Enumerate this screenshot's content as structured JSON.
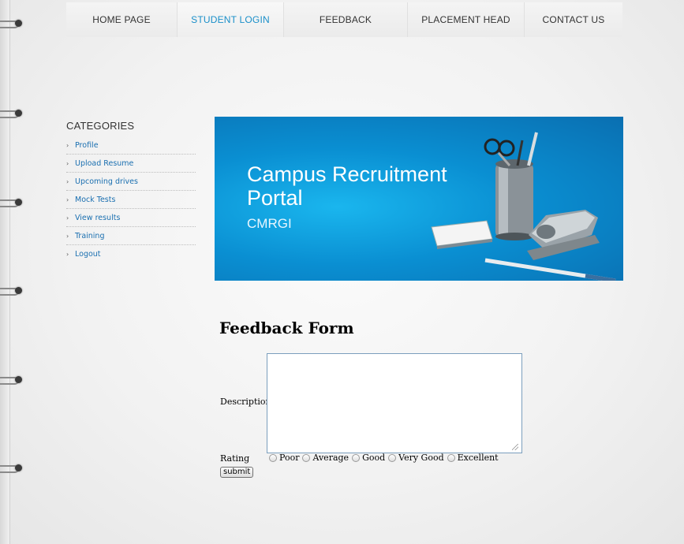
{
  "nav": {
    "items": [
      {
        "label": "HOME PAGE"
      },
      {
        "label": "STUDENT LOGIN"
      },
      {
        "label": "FEEDBACK"
      },
      {
        "label": "PLACEMENT HEAD"
      },
      {
        "label": "CONTACT US"
      }
    ],
    "active_color": "#1a8fc9"
  },
  "sidebar": {
    "title": "CATEGORIES",
    "items": [
      {
        "label": "Profile"
      },
      {
        "label": "Upload Resume"
      },
      {
        "label": "Upcoming drives"
      },
      {
        "label": "Mock Tests"
      },
      {
        "label": "View results"
      },
      {
        "label": "Training"
      },
      {
        "label": "Logout"
      }
    ]
  },
  "banner": {
    "line1": "Campus Recruitment",
    "line2": "Portal",
    "line3": "CMRGI"
  },
  "form": {
    "title": "Feedback Form",
    "description_label": "Description",
    "description_value": "",
    "rating_label": "Rating",
    "rating_options": [
      "Poor",
      "Average",
      "Good",
      "Very Good",
      "Excellent"
    ],
    "submit_label": "submit"
  }
}
